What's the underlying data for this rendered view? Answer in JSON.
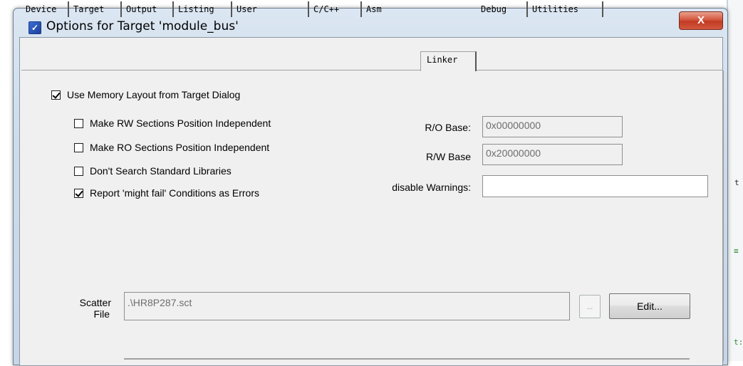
{
  "window": {
    "title": "Options for Target 'module_bus'",
    "title_icon": "keil-uvision-icon",
    "close_label": "X"
  },
  "tabs": [
    {
      "label": "Device"
    },
    {
      "label": "Target"
    },
    {
      "label": "Output"
    },
    {
      "label": "Listing"
    },
    {
      "label": "User"
    },
    {
      "label": "C/C++"
    },
    {
      "label": "Asm"
    },
    {
      "label": "Linker",
      "active": true
    },
    {
      "label": "Debug"
    },
    {
      "label": "Utilities"
    }
  ],
  "linker": {
    "use_memory_layout": {
      "label": "Use Memory Layout from Target Dialog",
      "checked": true
    },
    "options": [
      {
        "label": "Make RW Sections Position Independent",
        "checked": false
      },
      {
        "label": "Make RO Sections Position Independent",
        "checked": false
      },
      {
        "label": "Don't Search Standard Libraries",
        "checked": false
      },
      {
        "label": "Report 'might fail' Conditions as Errors",
        "checked": true
      }
    ],
    "ro_base": {
      "label": "R/O Base:",
      "value": "0x00000000"
    },
    "rw_base": {
      "label": "R/W Base",
      "value": "0x20000000"
    },
    "disable_warnings": {
      "label": "disable Warnings:",
      "value": ""
    },
    "scatter_file": {
      "label_line1": "Scatter",
      "label_line2": "File",
      "value": ".\\HR8P287.sct",
      "browse_label": "...",
      "edit_label": "Edit..."
    }
  },
  "background": {
    "glyph_1": "t",
    "glyph_2": "≡",
    "glyph_3": "t:"
  },
  "colors": {
    "close_button": "#c23b22",
    "dialog_face": "#f0f0f0",
    "title_gradient": "#dbe6f2"
  }
}
